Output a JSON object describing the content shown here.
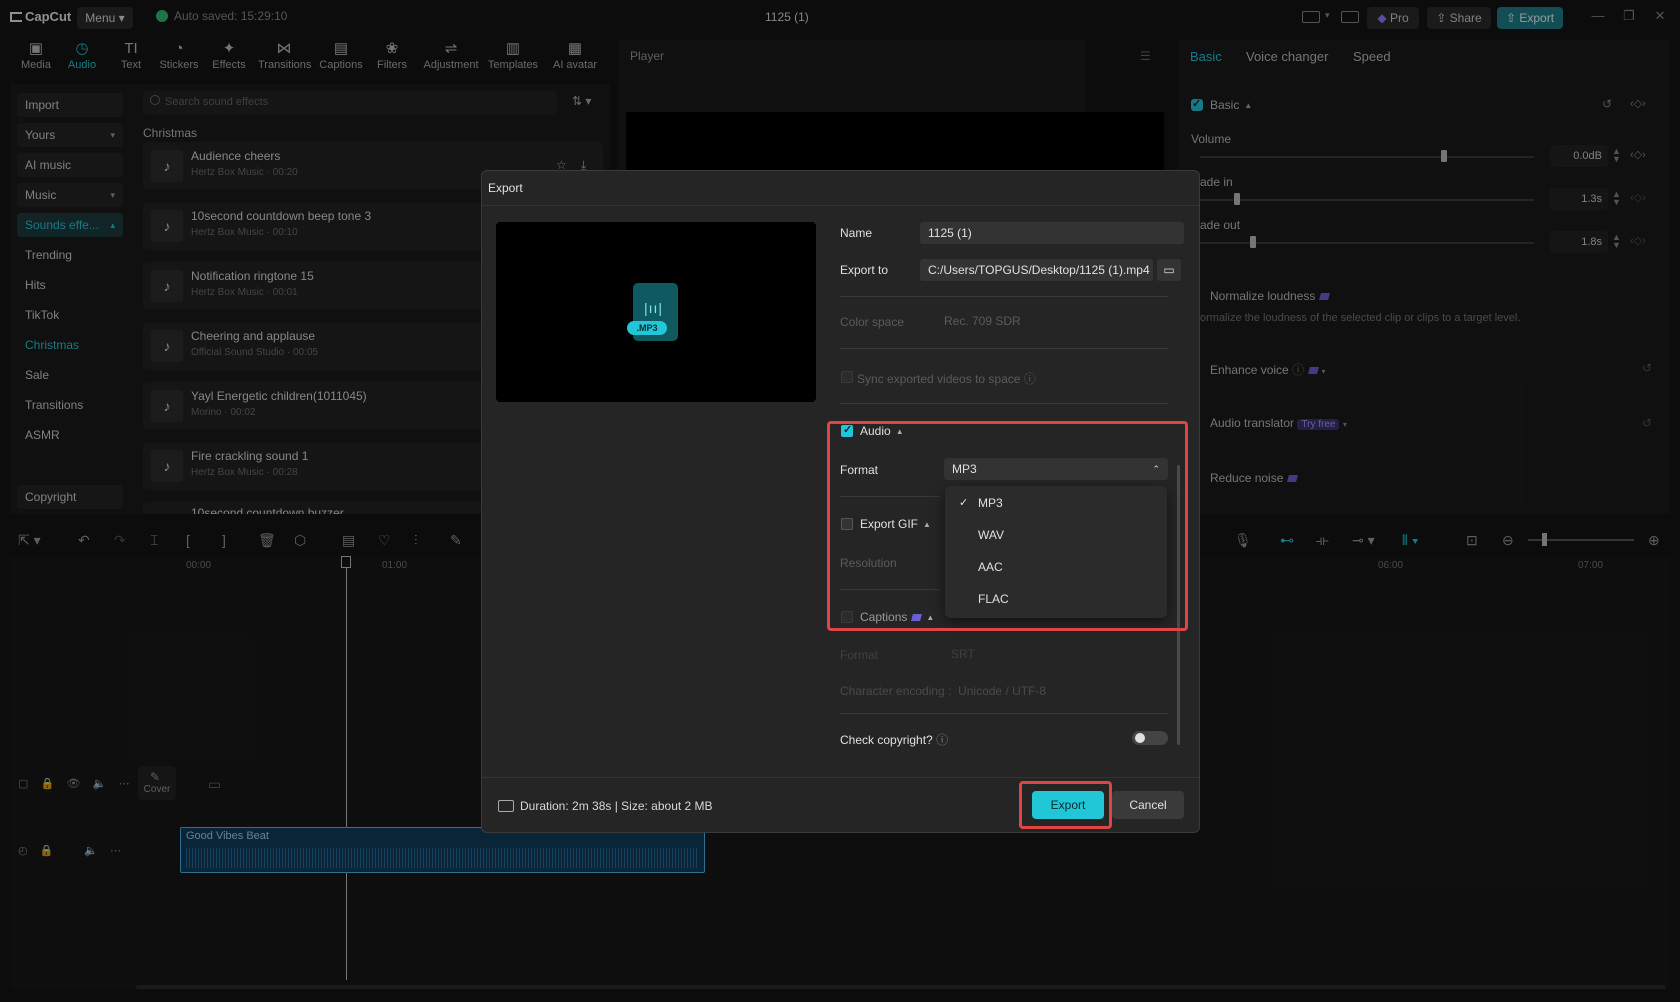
{
  "app": {
    "name": "CapCut",
    "menu_label": "Menu",
    "autosave": "Auto saved: 15:29:10",
    "doc_title": "1125 (1)",
    "pro_label": "Pro",
    "share_label": "Share",
    "export_label": "Export"
  },
  "tools": [
    {
      "label": "Media",
      "icon": "media-icon"
    },
    {
      "label": "Audio",
      "icon": "audio-icon"
    },
    {
      "label": "Text",
      "icon": "text-icon"
    },
    {
      "label": "Stickers",
      "icon": "sticker-icon"
    },
    {
      "label": "Effects",
      "icon": "effects-icon"
    },
    {
      "label": "Transitions",
      "icon": "transitions-icon"
    },
    {
      "label": "Captions",
      "icon": "captions-icon"
    },
    {
      "label": "Filters",
      "icon": "filters-icon"
    },
    {
      "label": "Adjustment",
      "icon": "adjustment-icon"
    },
    {
      "label": "Templates",
      "icon": "templates-icon"
    },
    {
      "label": "AI avatar",
      "icon": "avatar-icon"
    }
  ],
  "leftnav": [
    "Import",
    "Yours",
    "AI music",
    "Music",
    "Sounds effe...",
    "Trending",
    "Hits",
    "TikTok",
    "Christmas",
    "Sale",
    "Transitions",
    "ASMR",
    "Copyright"
  ],
  "sounds": {
    "search_placeholder": "Search sound effects",
    "section": "Christmas",
    "items": [
      {
        "title": "Audience cheers",
        "sub": "Hertz Box Music · 00:20"
      },
      {
        "title": "10second countdown beep tone 3",
        "sub": "Hertz Box Music · 00:10"
      },
      {
        "title": "Notification ringtone 15",
        "sub": "Hertz Box Music · 00:01"
      },
      {
        "title": "Cheering and applause",
        "sub": "Official Sound Studio · 00:05"
      },
      {
        "title": "Yayl Energetic children(1011045)",
        "sub": "Morino · 00:02"
      },
      {
        "title": "Fire crackling sound 1",
        "sub": "Hertz Box Music · 00:28"
      },
      {
        "title": "10second countdown buzzer",
        "sub": ""
      }
    ]
  },
  "player": {
    "title": "Player"
  },
  "inspector": {
    "tabs": [
      "Basic",
      "Voice changer",
      "Speed"
    ],
    "basic_label": "Basic",
    "volume_label": "Volume",
    "volume_value": "0.0dB",
    "fadein_label": "ade in",
    "fadein_value": "1.3s",
    "fadeout_label": "ade out",
    "fadeout_value": "1.8s",
    "normalize_label": "Normalize loudness",
    "normalize_desc": "ormalize the loudness of the selected clip or clips to a target level.",
    "enhance_label": "Enhance voice",
    "translator_label": "Audio translator",
    "translator_badge": "Try free",
    "reduce_label": "Reduce noise"
  },
  "timeline": {
    "ruler": [
      "00:00",
      "01:00",
      "06:00",
      "07:00"
    ],
    "cover_label": "Cover",
    "clip_label": "Good Vibes Beat"
  },
  "dialog": {
    "title": "Export",
    "file_badge": ".MP3",
    "name_label": "Name",
    "name_value": "1125 (1)",
    "export_to_label": "Export to",
    "export_to_value": "C:/Users/TOPGUS/Desktop/1125 (1).mp4",
    "color_space_label": "Color space",
    "color_space_value": "Rec. 709 SDR",
    "sync_label": "Sync exported videos to space",
    "audio_label": "Audio",
    "format_label": "Format",
    "format_value": "MP3",
    "format_options": [
      "MP3",
      "WAV",
      "AAC",
      "FLAC"
    ],
    "gif_label": "Export GIF",
    "resolution_label": "Resolution",
    "captions_label": "Captions",
    "cap_format_label": "Format",
    "cap_format_value": "SRT",
    "encoding_label": "Character encoding :",
    "encoding_value": "Unicode / UTF-8",
    "copyright_label": "Check copyright?",
    "duration": "Duration: 2m 38s | Size: about 2 MB",
    "export_button": "Export",
    "cancel_button": "Cancel"
  },
  "colors": {
    "accent": "#21c7d6",
    "highlight": "#e04545"
  }
}
